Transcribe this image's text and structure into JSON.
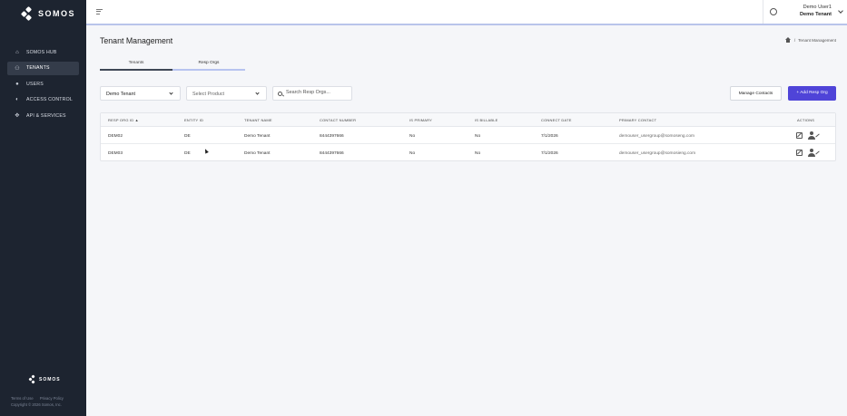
{
  "app": {
    "brand": "SOMOS",
    "brand_registered": "®"
  },
  "sidebar": {
    "items": [
      {
        "label": "SOMOS HUB",
        "icon": "home-icon"
      },
      {
        "label": "TENANTS",
        "icon": "tenants-icon",
        "active": true
      },
      {
        "label": "USERS",
        "icon": "user-icon"
      },
      {
        "label": "ACCESS CONTROL",
        "icon": "shield-icon"
      },
      {
        "label": "API & SERVICES",
        "icon": "api-icon"
      }
    ],
    "footer_brand": "SOMOS",
    "footer_links": [
      "Terms of Use",
      "Privacy Policy"
    ],
    "copyright": "Copyright © 2026 Somos, Inc."
  },
  "topbar": {
    "user_name": "Demo User1",
    "tenant_name": "Demo Tenant"
  },
  "page": {
    "title": "Tenant Management",
    "breadcrumb": "Tenant Management"
  },
  "tabs": [
    "Tenants",
    "Resp Orgs"
  ],
  "filters": {
    "tenant_value": "Demo Tenant",
    "product_placeholder": "Select Product",
    "search_placeholder": "Search Resp Orgs..."
  },
  "buttons": {
    "manage_contacts": "Manage Contacts",
    "add_resp_org": "+ Add Resp Org"
  },
  "table": {
    "columns": [
      "RESP ORG ID ▲",
      "ENTITY ID",
      "TENANT NAME",
      "CONTACT NUMBER",
      "IS PRIMARY",
      "IS BILLABLE",
      "CONNECT DATE",
      "PRIMARY CONTACT",
      "ACTIONS"
    ],
    "rows": [
      [
        "DEM02",
        "DE",
        "Demo Tenant",
        "8444397666",
        "No",
        "No",
        "7/1/2026",
        "demouser_usergroup@somoseng.com"
      ],
      [
        "DEM03",
        "DE",
        "Demo Tenant",
        "8444397666",
        "No",
        "No",
        "7/1/2026",
        "demouser_usergroup@somosieng.com"
      ]
    ]
  },
  "colors": {
    "sidebar_bg": "#1d2430",
    "accent": "#4f44d8",
    "tab_active_underline": "#b7c3f0"
  }
}
